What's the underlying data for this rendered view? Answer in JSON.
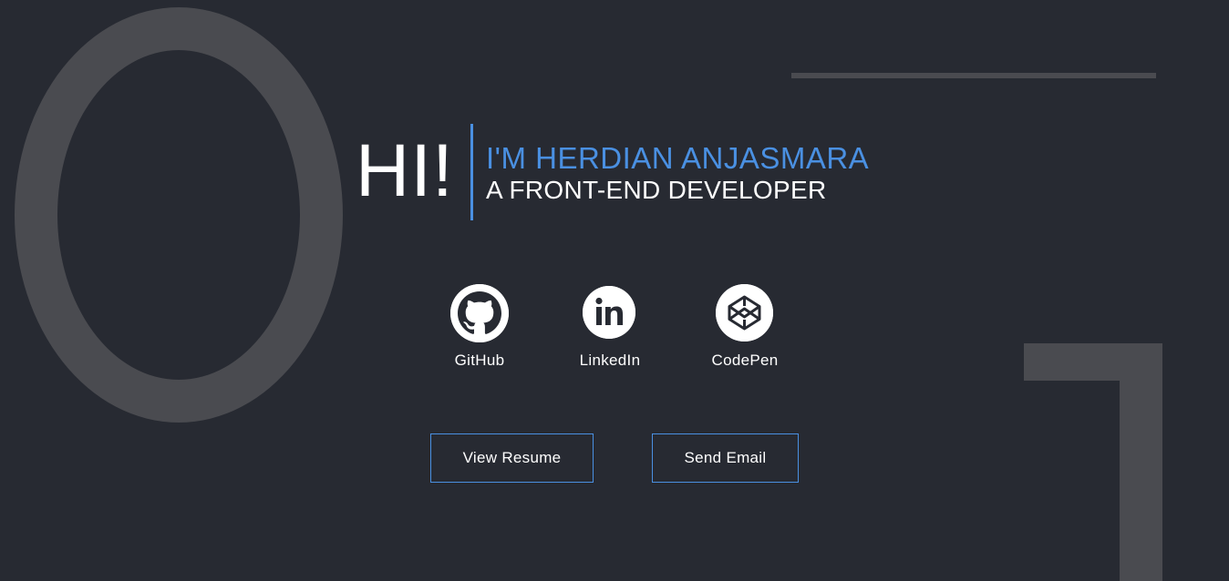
{
  "hero": {
    "greeting": "HI!",
    "name": "I'M HERDIAN ANJASMARA",
    "role": "A FRONT-END DEVELOPER"
  },
  "social": [
    {
      "label": "GitHub",
      "icon": "github-icon"
    },
    {
      "label": "LinkedIn",
      "icon": "linkedin-icon"
    },
    {
      "label": "CodePen",
      "icon": "codepen-icon"
    }
  ],
  "actions": {
    "resume_label": "View Resume",
    "email_label": "Send Email"
  },
  "colors": {
    "background": "#272a32",
    "decor": "#4a4b50",
    "accent": "#4a90e2",
    "text": "#ffffff"
  }
}
